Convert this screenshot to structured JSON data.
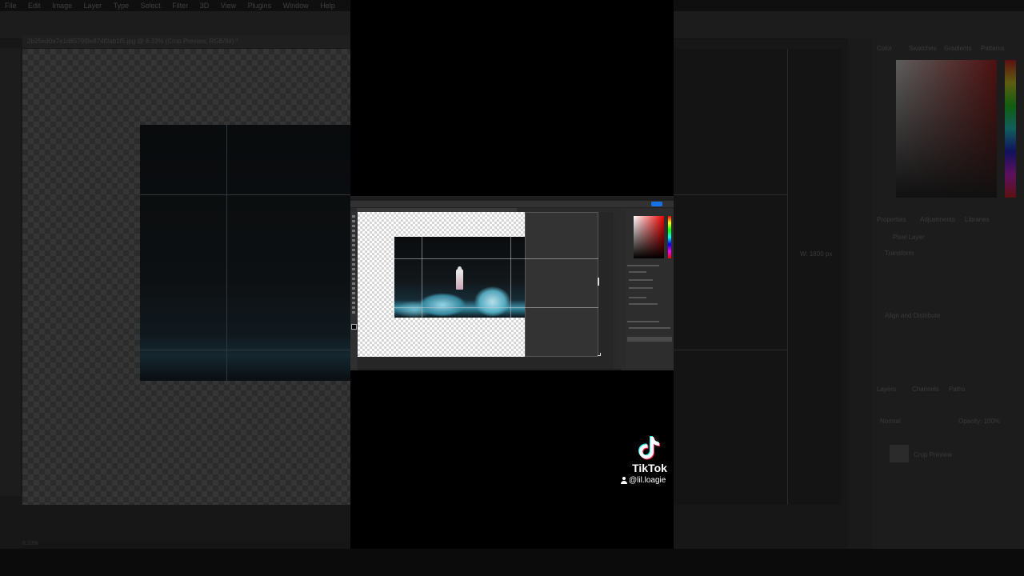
{
  "background_app": {
    "menu_items": [
      "File",
      "Edit",
      "Image",
      "Layer",
      "Type",
      "Select",
      "Filter",
      "3D",
      "View",
      "Plugins",
      "Window",
      "Help"
    ],
    "document_tab": "2b25ed0a7e1d8579f8e874f0ab1f5.jpg @ 8.33% (Crop Preview, RGB/8#) *",
    "zoom_status": "8.33%",
    "ruler_readout": "W: 1800 px",
    "panels": {
      "color_tabs": [
        "Color",
        "Swatches",
        "Gradients",
        "Patterns"
      ],
      "properties_tabs": [
        "Properties",
        "Adjustments",
        "Libraries"
      ],
      "properties_section": "Pixel Layer",
      "transform": "Transform",
      "align": "Align and Distribute",
      "layers_tabs": [
        "Layers",
        "Channels",
        "Paths"
      ],
      "blend_mode": "Normal",
      "opacity": "Opacity: 100%",
      "layer_name": "Crop Preview"
    }
  },
  "tiktok": {
    "brand": "TikTok",
    "handle": "@lil.loagie"
  }
}
